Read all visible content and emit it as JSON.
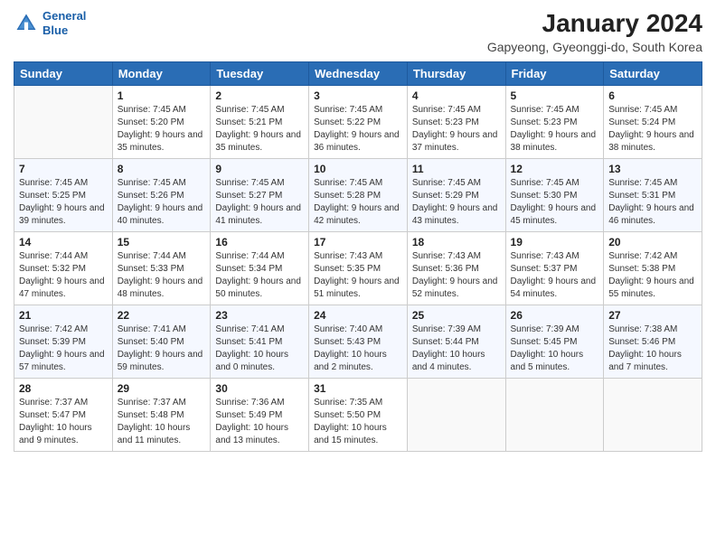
{
  "header": {
    "logo_line1": "General",
    "logo_line2": "Blue",
    "title": "January 2024",
    "subtitle": "Gapyeong, Gyeonggi-do, South Korea"
  },
  "weekdays": [
    "Sunday",
    "Monday",
    "Tuesday",
    "Wednesday",
    "Thursday",
    "Friday",
    "Saturday"
  ],
  "weeks": [
    [
      {
        "day": "",
        "sunrise": "",
        "sunset": "",
        "daylight": ""
      },
      {
        "day": "1",
        "sunrise": "Sunrise: 7:45 AM",
        "sunset": "Sunset: 5:20 PM",
        "daylight": "Daylight: 9 hours and 35 minutes."
      },
      {
        "day": "2",
        "sunrise": "Sunrise: 7:45 AM",
        "sunset": "Sunset: 5:21 PM",
        "daylight": "Daylight: 9 hours and 35 minutes."
      },
      {
        "day": "3",
        "sunrise": "Sunrise: 7:45 AM",
        "sunset": "Sunset: 5:22 PM",
        "daylight": "Daylight: 9 hours and 36 minutes."
      },
      {
        "day": "4",
        "sunrise": "Sunrise: 7:45 AM",
        "sunset": "Sunset: 5:23 PM",
        "daylight": "Daylight: 9 hours and 37 minutes."
      },
      {
        "day": "5",
        "sunrise": "Sunrise: 7:45 AM",
        "sunset": "Sunset: 5:23 PM",
        "daylight": "Daylight: 9 hours and 38 minutes."
      },
      {
        "day": "6",
        "sunrise": "Sunrise: 7:45 AM",
        "sunset": "Sunset: 5:24 PM",
        "daylight": "Daylight: 9 hours and 38 minutes."
      }
    ],
    [
      {
        "day": "7",
        "sunrise": "Sunrise: 7:45 AM",
        "sunset": "Sunset: 5:25 PM",
        "daylight": "Daylight: 9 hours and 39 minutes."
      },
      {
        "day": "8",
        "sunrise": "Sunrise: 7:45 AM",
        "sunset": "Sunset: 5:26 PM",
        "daylight": "Daylight: 9 hours and 40 minutes."
      },
      {
        "day": "9",
        "sunrise": "Sunrise: 7:45 AM",
        "sunset": "Sunset: 5:27 PM",
        "daylight": "Daylight: 9 hours and 41 minutes."
      },
      {
        "day": "10",
        "sunrise": "Sunrise: 7:45 AM",
        "sunset": "Sunset: 5:28 PM",
        "daylight": "Daylight: 9 hours and 42 minutes."
      },
      {
        "day": "11",
        "sunrise": "Sunrise: 7:45 AM",
        "sunset": "Sunset: 5:29 PM",
        "daylight": "Daylight: 9 hours and 43 minutes."
      },
      {
        "day": "12",
        "sunrise": "Sunrise: 7:45 AM",
        "sunset": "Sunset: 5:30 PM",
        "daylight": "Daylight: 9 hours and 45 minutes."
      },
      {
        "day": "13",
        "sunrise": "Sunrise: 7:45 AM",
        "sunset": "Sunset: 5:31 PM",
        "daylight": "Daylight: 9 hours and 46 minutes."
      }
    ],
    [
      {
        "day": "14",
        "sunrise": "Sunrise: 7:44 AM",
        "sunset": "Sunset: 5:32 PM",
        "daylight": "Daylight: 9 hours and 47 minutes."
      },
      {
        "day": "15",
        "sunrise": "Sunrise: 7:44 AM",
        "sunset": "Sunset: 5:33 PM",
        "daylight": "Daylight: 9 hours and 48 minutes."
      },
      {
        "day": "16",
        "sunrise": "Sunrise: 7:44 AM",
        "sunset": "Sunset: 5:34 PM",
        "daylight": "Daylight: 9 hours and 50 minutes."
      },
      {
        "day": "17",
        "sunrise": "Sunrise: 7:43 AM",
        "sunset": "Sunset: 5:35 PM",
        "daylight": "Daylight: 9 hours and 51 minutes."
      },
      {
        "day": "18",
        "sunrise": "Sunrise: 7:43 AM",
        "sunset": "Sunset: 5:36 PM",
        "daylight": "Daylight: 9 hours and 52 minutes."
      },
      {
        "day": "19",
        "sunrise": "Sunrise: 7:43 AM",
        "sunset": "Sunset: 5:37 PM",
        "daylight": "Daylight: 9 hours and 54 minutes."
      },
      {
        "day": "20",
        "sunrise": "Sunrise: 7:42 AM",
        "sunset": "Sunset: 5:38 PM",
        "daylight": "Daylight: 9 hours and 55 minutes."
      }
    ],
    [
      {
        "day": "21",
        "sunrise": "Sunrise: 7:42 AM",
        "sunset": "Sunset: 5:39 PM",
        "daylight": "Daylight: 9 hours and 57 minutes."
      },
      {
        "day": "22",
        "sunrise": "Sunrise: 7:41 AM",
        "sunset": "Sunset: 5:40 PM",
        "daylight": "Daylight: 9 hours and 59 minutes."
      },
      {
        "day": "23",
        "sunrise": "Sunrise: 7:41 AM",
        "sunset": "Sunset: 5:41 PM",
        "daylight": "Daylight: 10 hours and 0 minutes."
      },
      {
        "day": "24",
        "sunrise": "Sunrise: 7:40 AM",
        "sunset": "Sunset: 5:43 PM",
        "daylight": "Daylight: 10 hours and 2 minutes."
      },
      {
        "day": "25",
        "sunrise": "Sunrise: 7:39 AM",
        "sunset": "Sunset: 5:44 PM",
        "daylight": "Daylight: 10 hours and 4 minutes."
      },
      {
        "day": "26",
        "sunrise": "Sunrise: 7:39 AM",
        "sunset": "Sunset: 5:45 PM",
        "daylight": "Daylight: 10 hours and 5 minutes."
      },
      {
        "day": "27",
        "sunrise": "Sunrise: 7:38 AM",
        "sunset": "Sunset: 5:46 PM",
        "daylight": "Daylight: 10 hours and 7 minutes."
      }
    ],
    [
      {
        "day": "28",
        "sunrise": "Sunrise: 7:37 AM",
        "sunset": "Sunset: 5:47 PM",
        "daylight": "Daylight: 10 hours and 9 minutes."
      },
      {
        "day": "29",
        "sunrise": "Sunrise: 7:37 AM",
        "sunset": "Sunset: 5:48 PM",
        "daylight": "Daylight: 10 hours and 11 minutes."
      },
      {
        "day": "30",
        "sunrise": "Sunrise: 7:36 AM",
        "sunset": "Sunset: 5:49 PM",
        "daylight": "Daylight: 10 hours and 13 minutes."
      },
      {
        "day": "31",
        "sunrise": "Sunrise: 7:35 AM",
        "sunset": "Sunset: 5:50 PM",
        "daylight": "Daylight: 10 hours and 15 minutes."
      },
      {
        "day": "",
        "sunrise": "",
        "sunset": "",
        "daylight": ""
      },
      {
        "day": "",
        "sunrise": "",
        "sunset": "",
        "daylight": ""
      },
      {
        "day": "",
        "sunrise": "",
        "sunset": "",
        "daylight": ""
      }
    ]
  ]
}
